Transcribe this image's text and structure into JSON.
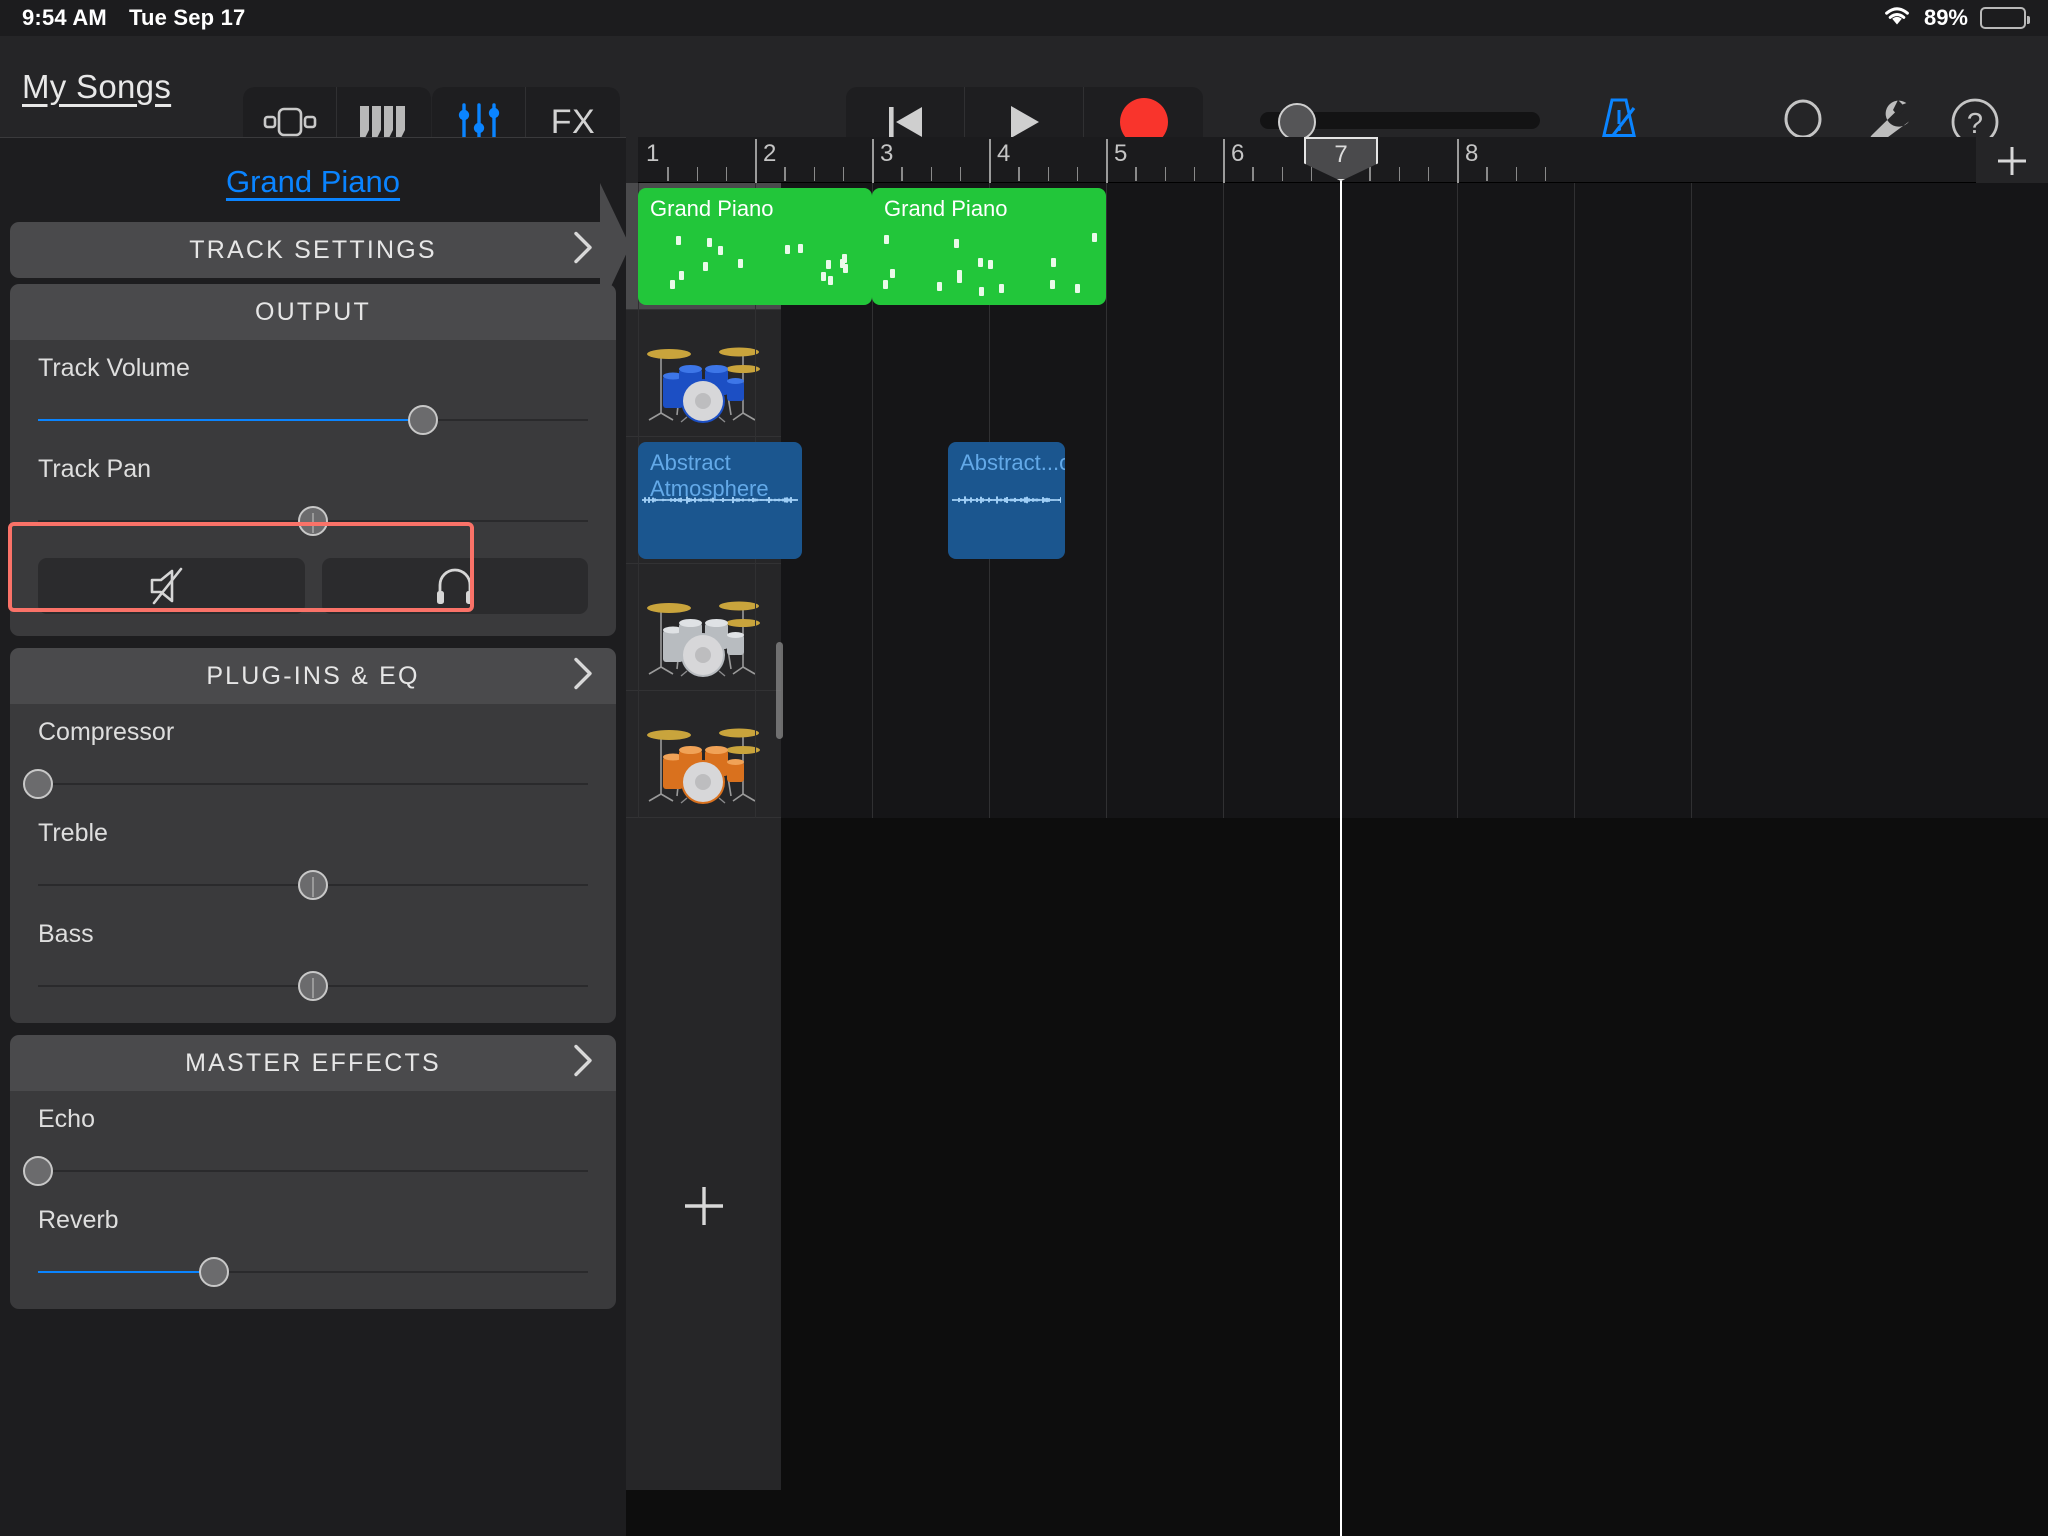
{
  "status_bar": {
    "time": "9:54 AM",
    "date": "Tue Sep 17",
    "wifi_icon": "wifi-icon",
    "battery_percent": "89%",
    "battery_level": 89
  },
  "toolbar": {
    "my_songs_label": "My Songs",
    "view_buttons": [
      {
        "name": "tracks-view-icon",
        "label": ""
      },
      {
        "name": "instrument-keyboard-icon",
        "label": ""
      }
    ],
    "mixer_buttons": [
      {
        "name": "mixer-sliders-icon",
        "label": ""
      },
      {
        "name": "fx-button",
        "label": "FX"
      }
    ],
    "transport": [
      {
        "name": "rewind-to-start-button",
        "label": ""
      },
      {
        "name": "play-button",
        "label": ""
      },
      {
        "name": "record-button",
        "label": ""
      }
    ],
    "master_volume_percent": 9,
    "right_icons": [
      {
        "name": "metronome-icon",
        "active": true
      },
      {
        "name": "loop-browser-icon",
        "active": false
      },
      {
        "name": "settings-wrench-icon",
        "active": false
      },
      {
        "name": "help-icon",
        "active": false
      }
    ]
  },
  "left_panel": {
    "track_name": "Grand Piano",
    "track_settings_label": "TRACK SETTINGS",
    "output": {
      "header_label": "OUTPUT",
      "controls": [
        {
          "label": "Track Volume",
          "value": 70,
          "fill": true,
          "centered": false,
          "highlighted": true
        },
        {
          "label": "Track Pan",
          "value": 50,
          "fill": false,
          "centered": true,
          "highlighted": false
        }
      ],
      "mute_button": "mute-icon",
      "solo_button": "solo-headphones-icon"
    },
    "plugins_eq": {
      "header_label": "PLUG-INS & EQ",
      "controls": [
        {
          "label": "Compressor",
          "value": 0,
          "fill": false,
          "centered": false
        },
        {
          "label": "Treble",
          "value": 50,
          "fill": false,
          "centered": true
        },
        {
          "label": "Bass",
          "value": 50,
          "fill": false,
          "centered": true
        }
      ]
    },
    "master_effects": {
      "header_label": "MASTER EFFECTS",
      "controls": [
        {
          "label": "Echo",
          "value": 0,
          "fill": false,
          "centered": false
        },
        {
          "label": "Reverb",
          "value": 32,
          "fill": true,
          "centered": false
        }
      ]
    },
    "chevron_icon": "chevron-right-icon",
    "accent_color": "#0a84ff",
    "highlight_color": "#fa7268"
  },
  "timeline": {
    "bar_numbers": [
      "1",
      "2",
      "3",
      "4",
      "5",
      "6",
      "7",
      "8"
    ],
    "beats_per_bar": 4,
    "playhead_bar": "7",
    "add_track_icon": "plus-icon",
    "tracks": [
      {
        "instrument_icon": "grand-piano-icon",
        "selected": true,
        "regions": [
          {
            "label": "Grand Piano",
            "type": "midi",
            "start_bar": 1.0,
            "end_bar": 3.0
          },
          {
            "label": "Grand Piano",
            "type": "midi",
            "start_bar": 3.0,
            "end_bar": 5.0
          }
        ]
      },
      {
        "instrument_icon": "blue-drum-kit-icon",
        "selected": false,
        "regions": []
      },
      {
        "instrument_icon": "red-keyboard-icon",
        "selected": false,
        "regions": [
          {
            "label": "Abstract Atmosphere",
            "type": "audio",
            "start_bar": 1.0,
            "end_bar": 2.4
          },
          {
            "label": "Abstract...osphere",
            "type": "audio",
            "start_bar": 3.65,
            "end_bar": 4.65
          }
        ]
      },
      {
        "instrument_icon": "silver-drum-kit-icon",
        "selected": false,
        "regions": []
      },
      {
        "instrument_icon": "orange-drum-kit-icon",
        "selected": false,
        "regions": []
      }
    ],
    "add_track_button": "add-track-plus-icon"
  }
}
